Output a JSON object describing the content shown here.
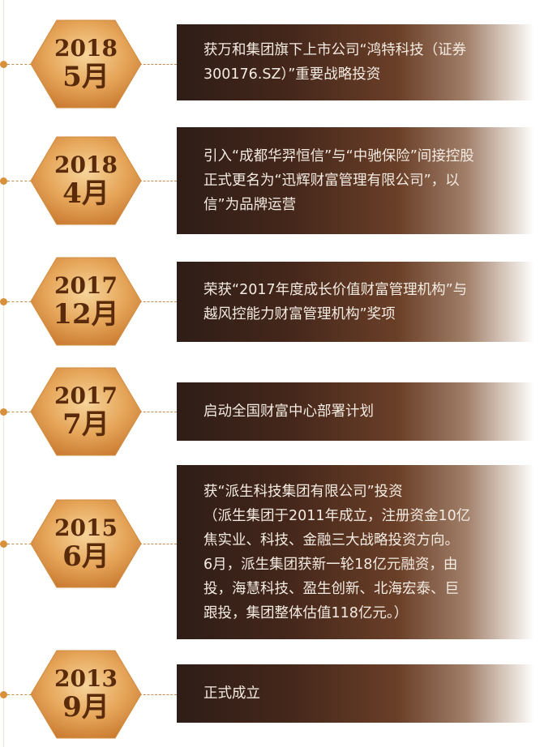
{
  "colors": {
    "accent_dot": "#d9903a",
    "hexagon_gold": "#e6a65a",
    "hexagon_text": "#5a2b0b",
    "card_dark": "#2e1d17",
    "card_text": "#f4ebe2"
  },
  "timeline": [
    {
      "year": "2018",
      "month": "5月",
      "lines": [
        "获万和集团旗下上市公司“鸿特科技（证券",
        "300176.SZ）”重要战略投资"
      ]
    },
    {
      "year": "2018",
      "month": "4月",
      "lines": [
        "引入“成都华羿恒信”与“中驰保险”间接控股",
        "正式更名为“迅辉财富管理有限公司”，以",
        "信”为品牌运营"
      ]
    },
    {
      "year": "2017",
      "month": "12月",
      "lines": [
        "荣获“2017年度成长价值财富管理机构”与",
        "越风控能力财富管理机构”奖项"
      ]
    },
    {
      "year": "2017",
      "month": "7月",
      "lines": [
        "启动全国财富中心部署计划"
      ]
    },
    {
      "year": "2015",
      "month": "6月",
      "lines": [
        "获“派生科技集团有限公司”投资",
        "（派生集团于2011年成立，注册资金10亿",
        "焦实业、科技、金融三大战略投资方向。",
        "6月，派生集团获新一轮18亿元融资，由",
        "投，海慧科技、盈生创新、北海宏泰、巨",
        "跟投，集团整体估值118亿元。）"
      ]
    },
    {
      "year": "2013",
      "month": "9月",
      "lines": [
        "正式成立"
      ]
    }
  ]
}
